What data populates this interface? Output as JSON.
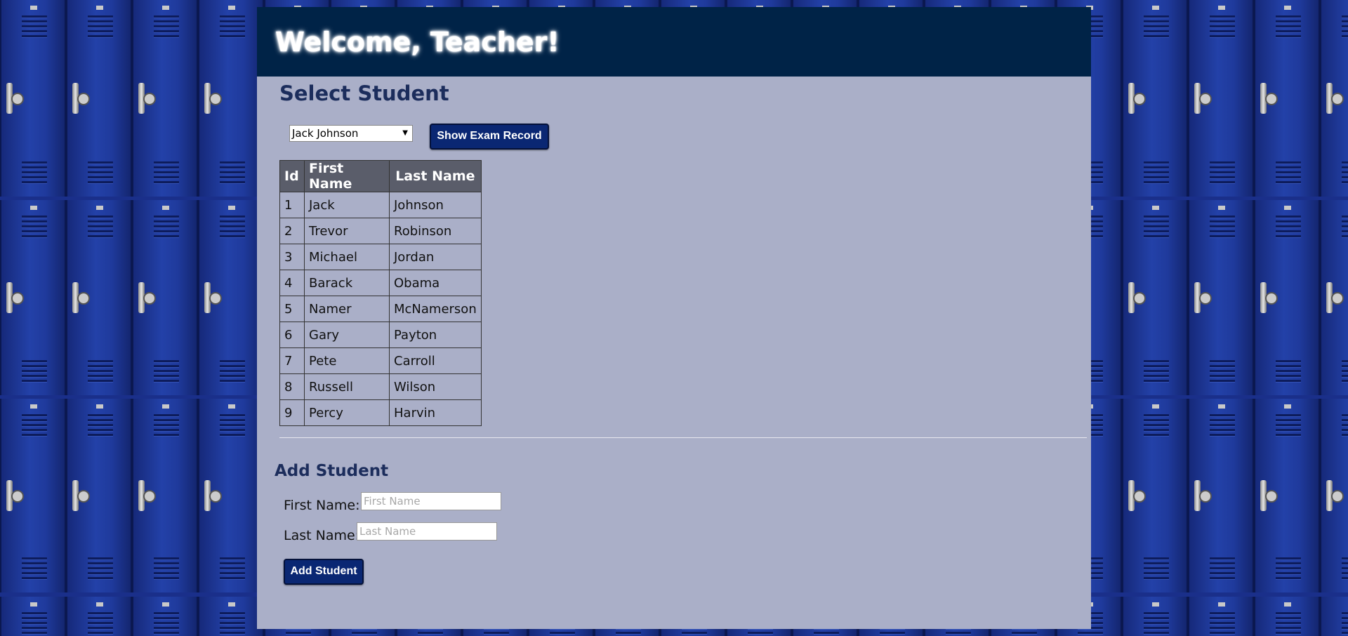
{
  "header": {
    "title": "Welcome, Teacher!"
  },
  "select_section": {
    "heading": "Select Student",
    "selected_student": "Jack Johnson",
    "button_label": "Show Exam Record"
  },
  "students_table": {
    "columns": [
      "Id",
      "First Name",
      "Last Name"
    ],
    "rows": [
      [
        "1",
        "Jack",
        "Johnson"
      ],
      [
        "2",
        "Trevor",
        "Robinson"
      ],
      [
        "3",
        "Michael",
        "Jordan"
      ],
      [
        "4",
        "Barack",
        "Obama"
      ],
      [
        "5",
        "Namer",
        "McNamerson"
      ],
      [
        "6",
        "Gary",
        "Payton"
      ],
      [
        "7",
        "Pete",
        "Carroll"
      ],
      [
        "8",
        "Russell",
        "Wilson"
      ],
      [
        "9",
        "Percy",
        "Harvin"
      ]
    ]
  },
  "add_section": {
    "heading": "Add Student",
    "first_label": "First Name:",
    "first_placeholder": "First Name",
    "last_label": "Last Name:",
    "last_placeholder": "Last Name",
    "button_label": "Add Student"
  },
  "colors": {
    "header_bg": "#002347",
    "panel_bg": "#aaafc8",
    "button_bg": "#0a2773",
    "locker_blue": "#1f3a9c"
  },
  "icons": {
    "select_arrow": "dropdown-arrow-icon"
  }
}
